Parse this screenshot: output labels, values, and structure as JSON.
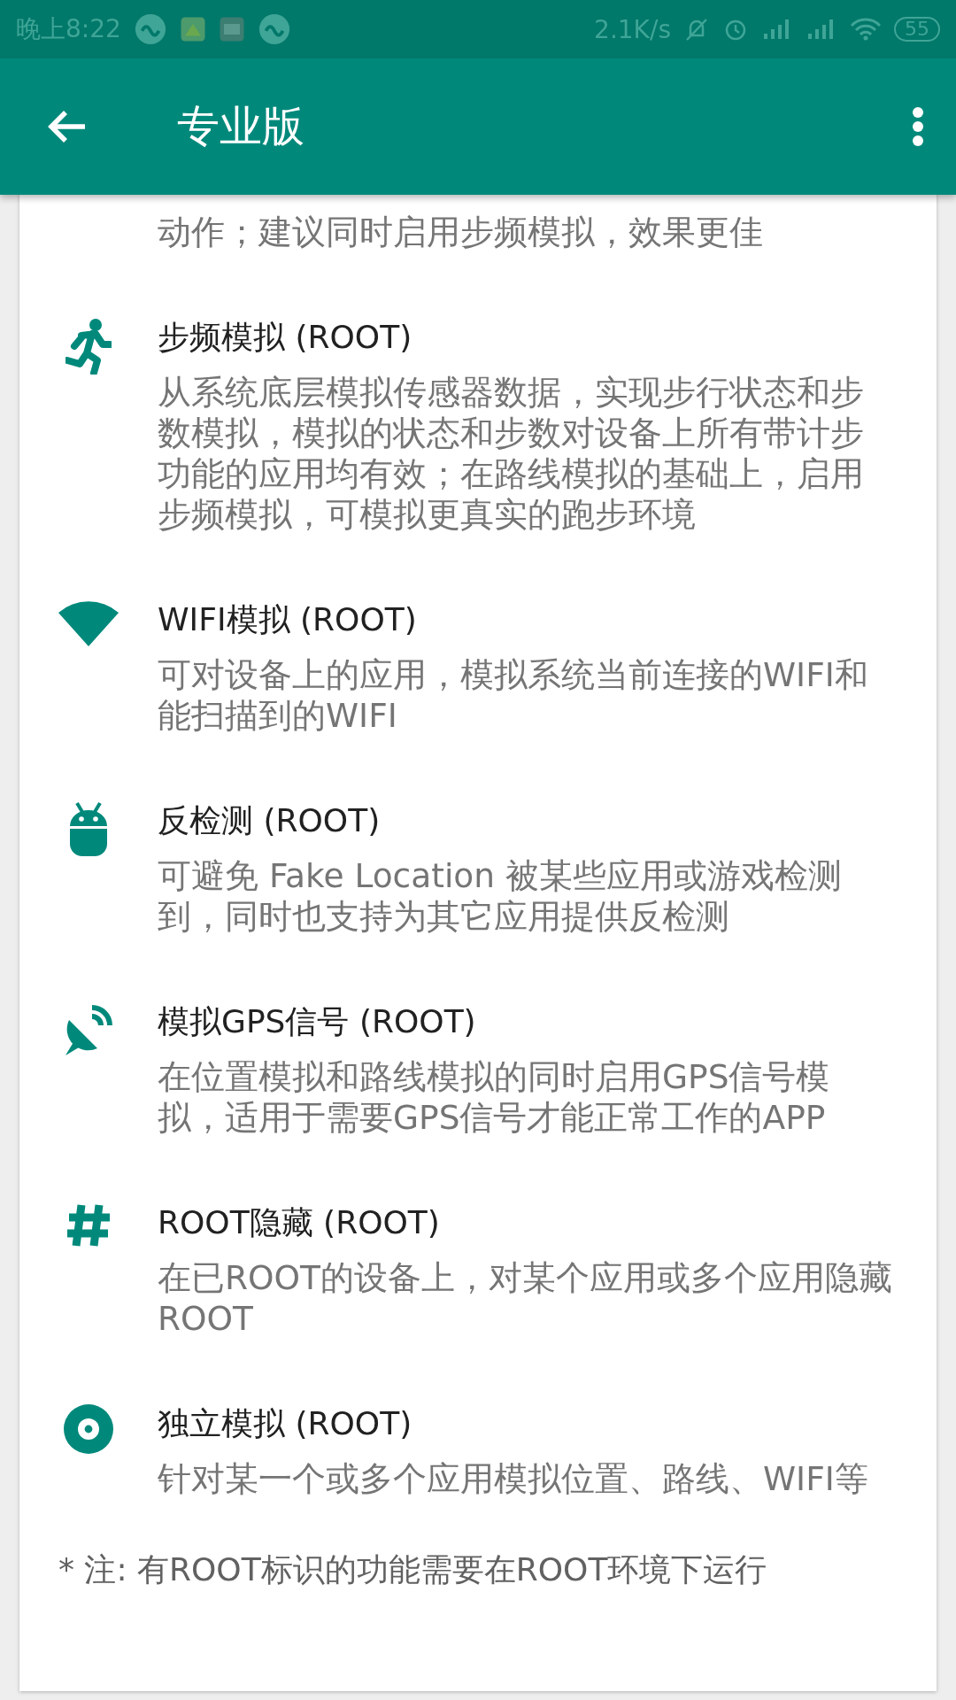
{
  "status_bar": {
    "time": "晚上8:22",
    "speed": "2.1K/s",
    "battery": "55"
  },
  "app_bar": {
    "title": "专业版"
  },
  "intro_fragment": "动作；建议同时启用步频模拟，效果更佳",
  "features": [
    {
      "title": "步频模拟 (ROOT)",
      "description": "从系统底层模拟传感器数据，实现步行状态和步数模拟，模拟的状态和步数对设备上所有带计步功能的应用均有效；在路线模拟的基础上，启用步频模拟，可模拟更真实的跑步环境"
    },
    {
      "title": "WIFI模拟 (ROOT)",
      "description": "可对设备上的应用，模拟系统当前连接的WIFI和能扫描到的WIFI"
    },
    {
      "title": "反检测 (ROOT)",
      "description": "可避免 Fake Location 被某些应用或游戏检测到，同时也支持为其它应用提供反检测"
    },
    {
      "title": "模拟GPS信号 (ROOT)",
      "description": "在位置模拟和路线模拟的同时启用GPS信号模拟，适用于需要GPS信号才能正常工作的APP"
    },
    {
      "title": "ROOT隐藏 (ROOT)",
      "description": "在已ROOT的设备上，对某个应用或多个应用隐藏ROOT"
    },
    {
      "title": "独立模拟 (ROOT)",
      "description": "针对某一个或多个应用模拟位置、路线、WIFI等"
    }
  ],
  "footnote": "* 注: 有ROOT标识的功能需要在ROOT环境下运行"
}
